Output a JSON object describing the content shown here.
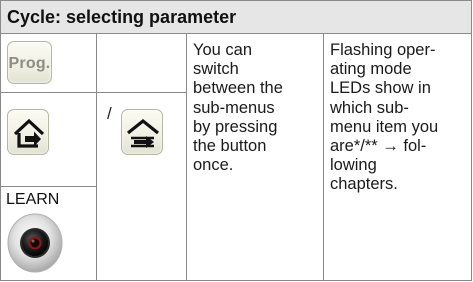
{
  "header": {
    "title": "Cycle: selecting parameter"
  },
  "buttons": {
    "prog_label": "Prog.",
    "separator": "/",
    "learn_label": "LEARN"
  },
  "description": {
    "col3": [
      "You can",
      "switch",
      "between the",
      "sub-menus",
      "by pressing",
      "the button",
      "once."
    ],
    "col4": [
      "Flashing oper-",
      "ating mode",
      "LEDs show in",
      "which sub-",
      "menu item you",
      "are*/** → fol-",
      "lowing",
      "chapters."
    ]
  },
  "icons": [
    "prog-button-icon",
    "home-arrow-right-icon",
    "up-arrow-right-icon",
    "learn-button-icon"
  ]
}
